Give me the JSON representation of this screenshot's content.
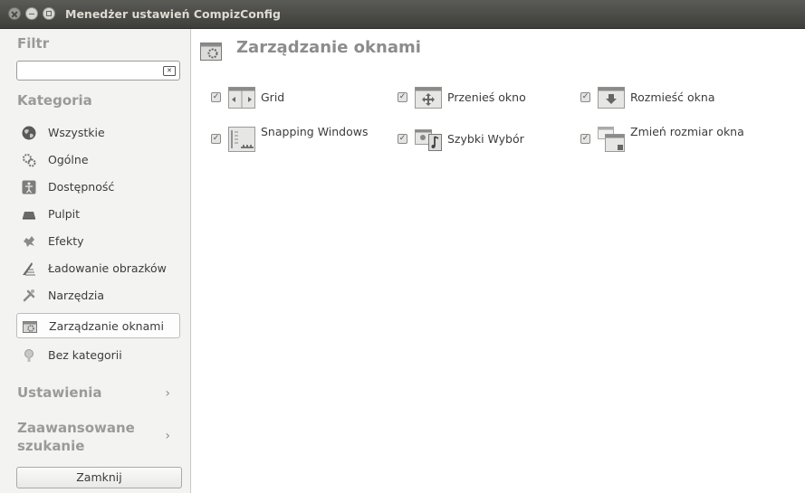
{
  "window": {
    "title": "Menedżer ustawień CompizConfig"
  },
  "sidebar": {
    "filter_title": "Filtr",
    "filter_value": "",
    "category_title": "Kategoria",
    "categories": [
      {
        "label": "Wszystkie",
        "icon": "globe-icon"
      },
      {
        "label": "Ogólne",
        "icon": "gears-icon"
      },
      {
        "label": "Dostępność",
        "icon": "accessibility-icon"
      },
      {
        "label": "Pulpit",
        "icon": "desktop-icon"
      },
      {
        "label": "Efekty",
        "icon": "effects-icon"
      },
      {
        "label": "Ładowanie obrazków",
        "icon": "image-loading-icon"
      },
      {
        "label": "Narzędzia",
        "icon": "tools-icon"
      },
      {
        "label": "Zarządzanie oknami",
        "icon": "window-management-icon",
        "selected": true
      },
      {
        "label": "Bez kategorii",
        "icon": "uncategorized-icon"
      }
    ],
    "settings_expander": "Ustawienia",
    "advanced_search_expander": "Zaawansowane szukanie",
    "close_button": "Zamknij"
  },
  "main": {
    "heading": "Zarządzanie oknami",
    "plugins": [
      {
        "label": "Grid",
        "checked": true,
        "icon": "grid-icon"
      },
      {
        "label": "Przenieś okno",
        "checked": true,
        "icon": "move-window-icon"
      },
      {
        "label": "Rozmieść okna",
        "checked": true,
        "icon": "place-windows-icon"
      },
      {
        "label": "Snapping Windows",
        "checked": true,
        "icon": "snapping-windows-icon"
      },
      {
        "label": "Szybki Wybór",
        "checked": true,
        "icon": "switcher-icon"
      },
      {
        "label": "Zmień rozmiar okna",
        "checked": true,
        "icon": "resize-window-icon"
      }
    ]
  },
  "colors": {
    "titlebar": "#3e3e3b",
    "sidebar_bg": "#f3f3f2",
    "heading_gray": "#8c8c8a"
  }
}
